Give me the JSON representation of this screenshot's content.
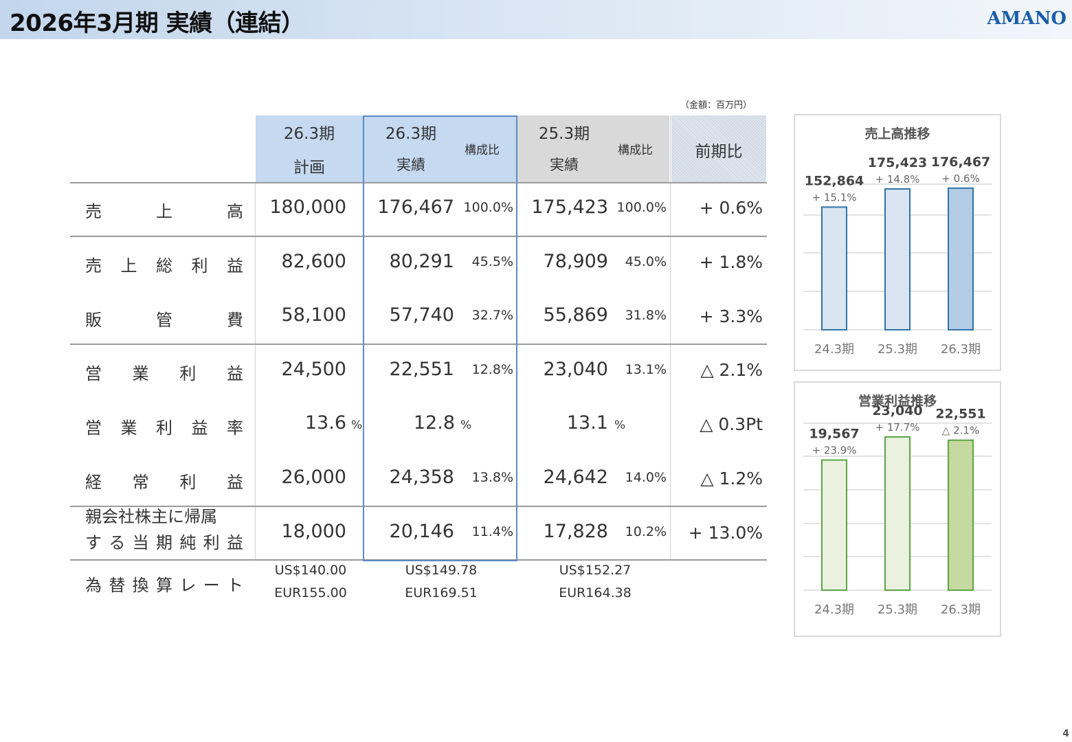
{
  "title": "2026年3月期 実績（連結）",
  "logo": "AMANO",
  "unit_note": "（金額：百万円）",
  "page_number": "4",
  "table": {
    "headers": {
      "plan_l1": "26.3期",
      "plan_l2": "計画",
      "act_l1": "26.3期",
      "act_l2": "実績",
      "act_ratio": "構成比",
      "prev_l1": "25.3期",
      "prev_l2": "実績",
      "prev_ratio": "構成比",
      "yoy": "前期比"
    },
    "rows": [
      {
        "label_parts": [
          "売",
          "上",
          "高"
        ],
        "plan": "180,000",
        "actual": "176,467",
        "actual_ratio": "100.0%",
        "prev": "175,423",
        "prev_ratio": "100.0%",
        "yoy": "+ 0.6%"
      },
      {
        "label_parts": [
          "売",
          "上",
          "総",
          "利",
          "益"
        ],
        "plan": "82,600",
        "actual": "80,291",
        "actual_ratio": "45.5%",
        "prev": "78,909",
        "prev_ratio": "45.0%",
        "yoy": "+ 1.8%"
      },
      {
        "label_parts": [
          "販",
          "管",
          "費"
        ],
        "plan": "58,100",
        "actual": "57,740",
        "actual_ratio": "32.7%",
        "prev": "55,869",
        "prev_ratio": "31.8%",
        "yoy": "+ 3.3%"
      },
      {
        "label_parts": [
          "営",
          "業",
          "利",
          "益"
        ],
        "plan": "24,500",
        "actual": "22,551",
        "actual_ratio": "12.8%",
        "prev": "23,040",
        "prev_ratio": "13.1%",
        "yoy": "△ 2.1%"
      },
      {
        "label_parts": [
          "営",
          "業",
          "利",
          "益",
          "率"
        ],
        "plan": "13.6",
        "plan_unit": "%",
        "actual": "12.8",
        "actual_unit": "%",
        "prev": "13.1",
        "prev_unit": "%",
        "yoy": "△ 0.3Pt"
      },
      {
        "label_parts": [
          "経",
          "常",
          "利",
          "益"
        ],
        "plan": "26,000",
        "actual": "24,358",
        "actual_ratio": "13.8%",
        "prev": "24,642",
        "prev_ratio": "14.0%",
        "yoy": "△ 1.2%"
      },
      {
        "label_line1": "親会社株主に帰属",
        "label_line2_parts": [
          "す",
          "る",
          "当",
          "期",
          "純",
          "利",
          "益"
        ],
        "plan": "18,000",
        "actual": "20,146",
        "actual_ratio": "11.4%",
        "prev": "17,828",
        "prev_ratio": "10.2%",
        "yoy": "+ 13.0%"
      }
    ],
    "fx": {
      "label_parts": [
        "為",
        "替",
        "換",
        "算",
        "レ",
        "ー",
        "ト"
      ],
      "plan_usd": "US$140.00",
      "plan_eur": "EUR155.00",
      "actual_usd": "US$149.78",
      "actual_eur": "EUR169.51",
      "prev_usd": "US$152.27",
      "prev_eur": "EUR164.38"
    }
  },
  "chart_data": [
    {
      "type": "bar",
      "title": "売上高推移",
      "categories": [
        "24.3期",
        "25.3期",
        "26.3期"
      ],
      "values": [
        152864,
        175423,
        176467
      ],
      "value_labels": [
        "152,864",
        "175,423",
        "176,467"
      ],
      "change_labels": [
        "+ 15.1%",
        "+ 14.8%",
        "+ 0.6%"
      ],
      "ylim": [
        0,
        190000
      ],
      "grid": true,
      "colors": {
        "fill": [
          "#dae5f2",
          "#dae5f2",
          "#b4cce6"
        ],
        "stroke": "#2e74a8"
      }
    },
    {
      "type": "bar",
      "title": "営業利益推移",
      "categories": [
        "24.3期",
        "25.3期",
        "26.3期"
      ],
      "values": [
        19567,
        23040,
        22551
      ],
      "value_labels": [
        "19,567",
        "23,040",
        "22,551"
      ],
      "change_labels": [
        "+ 23.9%",
        "+ 17.7%",
        "△ 2.1%"
      ],
      "ylim": [
        0,
        25000
      ],
      "grid": true,
      "colors": {
        "fill": [
          "#ebf1df",
          "#ebf1df",
          "#c6d9a0"
        ],
        "stroke": "#5aa544"
      }
    }
  ]
}
